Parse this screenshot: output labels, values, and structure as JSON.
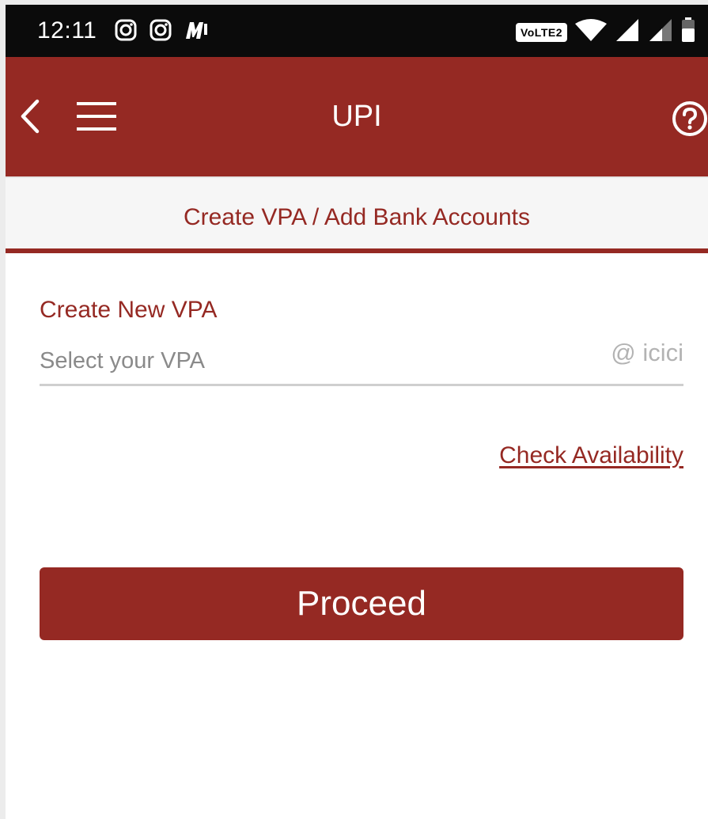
{
  "status_bar": {
    "time": "12:11",
    "left_icons": [
      "instagram-icon",
      "instagram-icon",
      "mi-app-icon"
    ],
    "network_badge": "VoLTE2",
    "right_icons": [
      "wifi-icon",
      "cell-signal-icon",
      "cell-signal-icon",
      "battery-icon"
    ]
  },
  "app_bar": {
    "title": "UPI",
    "back_icon": "chevron-left-icon",
    "menu_icon": "hamburger-menu-icon",
    "help_icon": "question-circle-icon"
  },
  "tab": {
    "label": "Create VPA / Add Bank Accounts"
  },
  "form": {
    "section_label": "Create New VPA",
    "vpa_placeholder": "Select your VPA",
    "vpa_value": "",
    "vpa_suffix": "@ icici",
    "check_availability": "Check Availability",
    "proceed": "Proceed"
  },
  "colors": {
    "brand": "#952923",
    "status_bar": "#0b0b0b",
    "tab_background": "#f6f6f6",
    "muted_text": "#8a8a8a"
  }
}
